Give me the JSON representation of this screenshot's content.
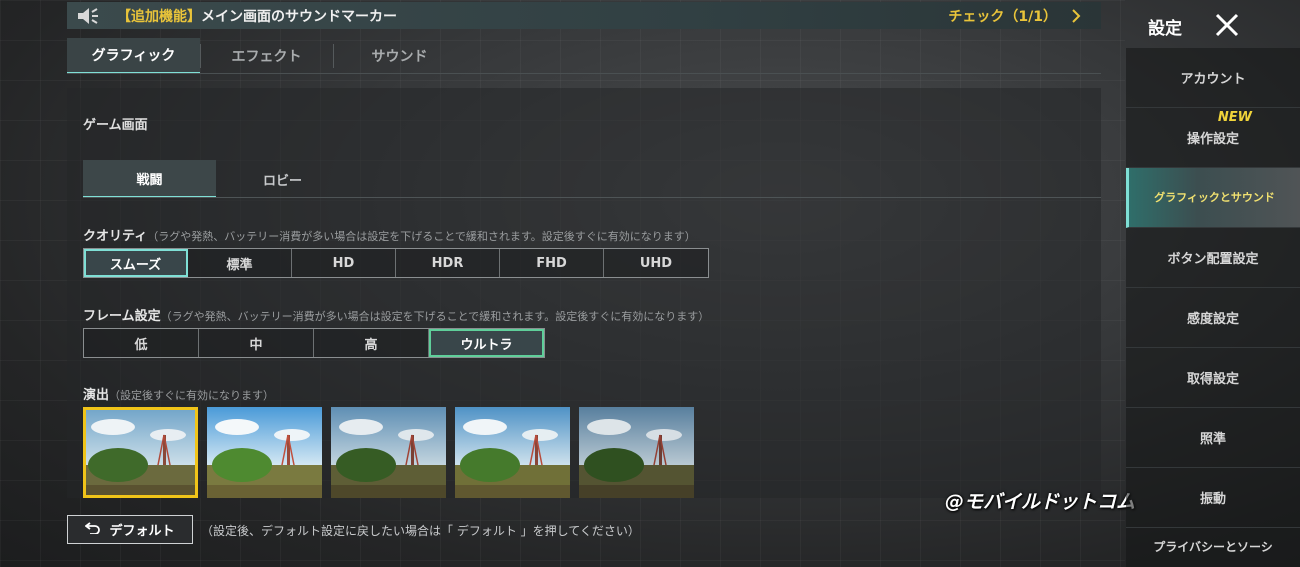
{
  "notice": {
    "tag": "【追加機能】",
    "text": "メイン画面のサウンドマーカー",
    "check": "チェック（1/1）"
  },
  "top_tabs": [
    "グラフィック",
    "エフェクト",
    "サウンド"
  ],
  "section_title": "ゲーム画面",
  "sub_tabs": [
    "戦闘",
    "ロビー"
  ],
  "quality": {
    "label": "クオリティ",
    "hint": "（ラグや発熱、バッテリー消費が多い場合は設定を下げることで緩和されます。設定後すぐに有効になります）",
    "options": [
      "スムーズ",
      "標準",
      "HD",
      "HDR",
      "FHD",
      "UHD"
    ],
    "selected": "スムーズ"
  },
  "frame": {
    "label": "フレーム設定",
    "hint": "（ラグや発熱、バッテリー消費が多い場合は設定を下げることで緩和されます。設定後すぐに有効になります）",
    "options": [
      "低",
      "中",
      "高",
      "ウルトラ"
    ],
    "selected": "ウルトラ"
  },
  "style": {
    "label": "演出",
    "hint": "（設定後すぐに有効になります）",
    "selected_index": 0
  },
  "default_button": {
    "label": "デフォルト"
  },
  "default_hint": "（設定後、デフォルト設定に戻したい場合は「 デフォルト 」を押してください）",
  "watermark": "@モバイルドットコム",
  "sidebar": {
    "title": "設定",
    "items": [
      "アカウント",
      "操作設定",
      "グラフィックとサウンド",
      "ボタン配置設定",
      "感度設定",
      "取得設定",
      "照準",
      "振動",
      "プライバシーとソーシ"
    ],
    "new_badge": "NEW",
    "active_index": 2
  },
  "colors": {
    "accent": "#7fe0d6",
    "highlight": "#e9c43a",
    "frame_selected": "#5fcf9a",
    "thumb_selected": "#f0c419"
  }
}
